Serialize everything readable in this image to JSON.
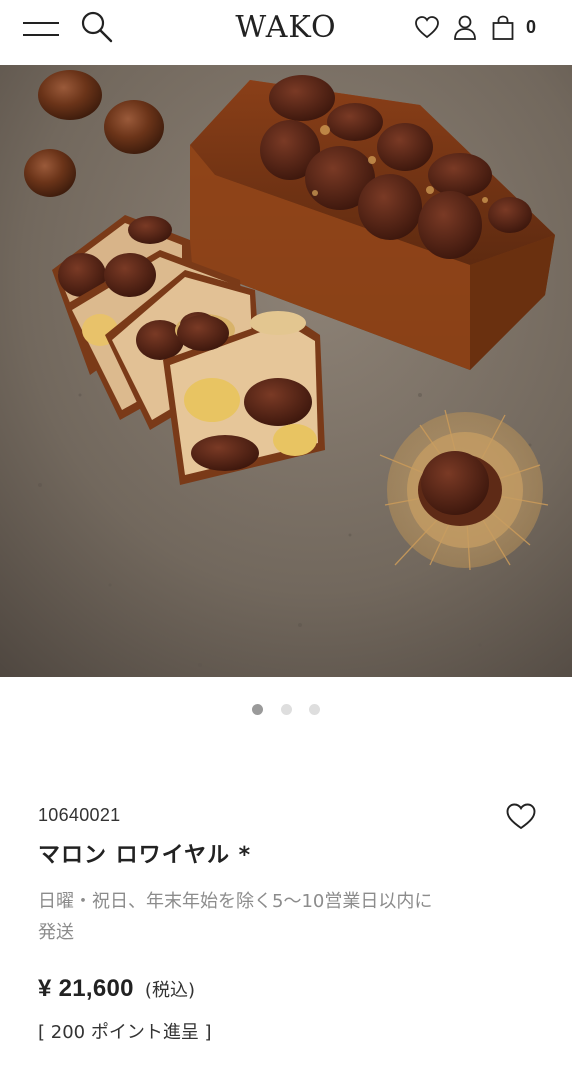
{
  "header": {
    "logo": "WAKO",
    "cart_count": "0",
    "icons": [
      "menu-icon",
      "search-icon",
      "heart-icon",
      "user-icon",
      "bag-icon"
    ]
  },
  "hero": {
    "carousel_count": 3,
    "active_index": 0
  },
  "product": {
    "code": "10640021",
    "name": "マロン ロワイヤル *",
    "shipping_line1": "日曜・祝日、年末年始を除く5〜10営業日以内に",
    "shipping_line2": "発送",
    "price": "¥ 21,600",
    "tax_label": "(税込)",
    "points": "[ 200 ポイント進呈 ]"
  }
}
